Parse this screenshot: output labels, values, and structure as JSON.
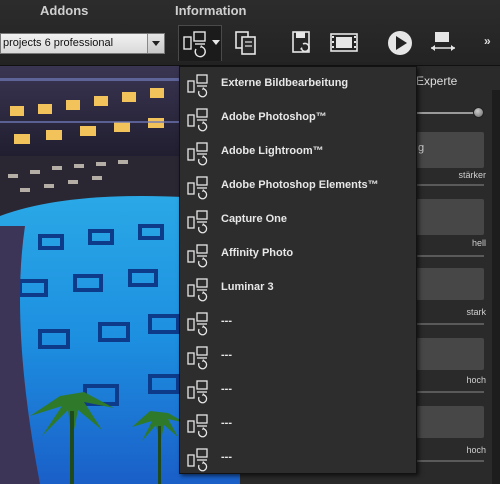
{
  "ribbon": {
    "addons_label": "Addons",
    "information_label": "Information",
    "addon_select_value": "projects 6 professional",
    "more_label": "»"
  },
  "toolbar": {
    "icons": [
      "external-editor-icon",
      "copy-document-icon",
      "save-icon",
      "filmstrip-icon",
      "play-icon",
      "resize-icon"
    ]
  },
  "menu": {
    "items": [
      {
        "label": "Externe Bildbearbeitung"
      },
      {
        "label": "Adobe Photoshop™"
      },
      {
        "label": "Adobe Lightroom™"
      },
      {
        "label": "Adobe Photoshop Elements™"
      },
      {
        "label": "Capture One"
      },
      {
        "label": "Affinity Photo"
      },
      {
        "label": "Luminar 3"
      },
      {
        "label": "---"
      },
      {
        "label": "---"
      },
      {
        "label": "---"
      },
      {
        "label": "---"
      },
      {
        "label": "---"
      }
    ]
  },
  "panel": {
    "tab_label": "Experte",
    "box_text": "g",
    "labels": [
      "stärker",
      "hell",
      "stark",
      "hoch",
      "hoch"
    ]
  }
}
